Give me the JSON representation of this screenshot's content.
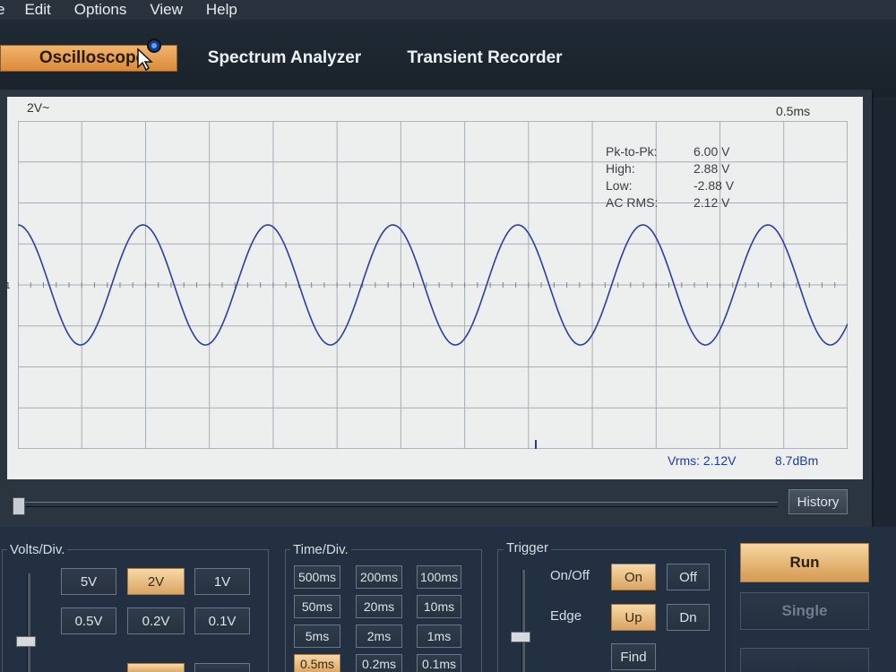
{
  "menu": [
    "e",
    "Edit",
    "Options",
    "View",
    "Help"
  ],
  "tabs": {
    "oscilloscope": "Oscilloscope",
    "spectrum": "Spectrum Analyzer",
    "transient": "Transient Recorder"
  },
  "screen": {
    "volts_div": "2V~",
    "time_div": "0.5ms",
    "channel_marker": "1",
    "measurements": [
      {
        "label": "Pk-to-Pk:",
        "value": "6.00 V"
      },
      {
        "label": "High:",
        "value": "2.88 V"
      },
      {
        "label": "Low:",
        "value": "-2.88 V"
      },
      {
        "label": "AC RMS:",
        "value": "2.12 V"
      }
    ],
    "vrms": "Vrms: 2.12V",
    "dbm": "8.7dBm"
  },
  "history_label": "History",
  "volts": {
    "title": "Volts/Div.",
    "buttons": [
      "5V",
      "2V",
      "1V",
      "0.5V",
      "0.2V",
      "0.1V"
    ],
    "selected": "2V"
  },
  "time": {
    "title": "Time/Div.",
    "buttons": [
      "500ms",
      "200ms",
      "100ms",
      "50ms",
      "20ms",
      "10ms",
      "5ms",
      "2ms",
      "1ms",
      "0.5ms",
      "0.2ms",
      "0.1ms"
    ],
    "selected": "0.5ms"
  },
  "trigger": {
    "title": "Trigger",
    "onoff_label": "On/Off",
    "on": "On",
    "off": "Off",
    "edge_label": "Edge",
    "up": "Up",
    "dn": "Dn",
    "find": "Find"
  },
  "run": "Run",
  "single": "Single",
  "colors": {
    "accent": "#e0a056",
    "trace": "#2b3fa0",
    "screen": "#ecefed"
  }
}
